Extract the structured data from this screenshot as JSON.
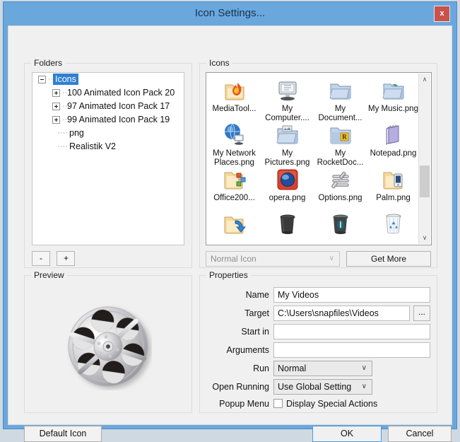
{
  "window": {
    "title": "Icon Settings...",
    "close_label": "x",
    "accent": "#6aa7dd",
    "close_bg": "#c9524a"
  },
  "folders": {
    "legend": "Folders",
    "tree": [
      {
        "label": "Icons",
        "expander": "minus",
        "level": 0,
        "selected": true
      },
      {
        "label": "100 Animated Icon Pack  20",
        "expander": "plus",
        "level": 1,
        "selected": false
      },
      {
        "label": "97 Animated Icon Pack  17",
        "expander": "plus",
        "level": 1,
        "selected": false
      },
      {
        "label": "99 Animated Icon Pack  19",
        "expander": "plus",
        "level": 1,
        "selected": false
      },
      {
        "label": "png",
        "expander": "none",
        "level": 1,
        "selected": false
      },
      {
        "label": "Realistik V2",
        "expander": "none",
        "level": 1,
        "selected": false
      }
    ],
    "remove_label": "-",
    "add_label": "+"
  },
  "preview": {
    "legend": "Preview",
    "icon_name": "film-reel-icon"
  },
  "icons": {
    "legend": "Icons",
    "items": [
      {
        "caption": "MediaTool...",
        "icon": "folder-flame-icon"
      },
      {
        "caption": "My Computer....",
        "icon": "monitor-icon"
      },
      {
        "caption": "My Document...",
        "icon": "folder-documents-icon"
      },
      {
        "caption": "My Music.png",
        "icon": "folder-music-icon"
      },
      {
        "caption": "My Network Places.png",
        "icon": "network-globe-icon"
      },
      {
        "caption": "My Pictures.png",
        "icon": "folder-pictures-icon"
      },
      {
        "caption": "My RocketDoc...",
        "icon": "folder-rocketdock-icon"
      },
      {
        "caption": "Notepad.png",
        "icon": "notepad-icon"
      },
      {
        "caption": "Office200...",
        "icon": "folder-office-icon"
      },
      {
        "caption": "opera.png",
        "icon": "opera-icon"
      },
      {
        "caption": "Options.png",
        "icon": "options-tools-icon"
      },
      {
        "caption": "Palm.png",
        "icon": "folder-palm-icon"
      },
      {
        "caption": "",
        "icon": "folder-restore-icon"
      },
      {
        "caption": "",
        "icon": "trash-black-icon"
      },
      {
        "caption": "",
        "icon": "trash-dark-icon"
      },
      {
        "caption": "",
        "icon": "recycle-bin-icon"
      }
    ],
    "type_select_value": "Normal Icon",
    "get_more_label": "Get More",
    "scroll_up": "∧",
    "scroll_down": "∨"
  },
  "properties": {
    "legend": "Properties",
    "fields": [
      {
        "label": "Name",
        "value": "My Videos",
        "kind": "text"
      },
      {
        "label": "Target",
        "value": "C:\\Users\\snapfiles\\Videos",
        "kind": "text-browse"
      },
      {
        "label": "Start in",
        "value": "",
        "kind": "text"
      },
      {
        "label": "Arguments",
        "value": "",
        "kind": "text"
      },
      {
        "label": "Run",
        "value": "Normal",
        "kind": "combo"
      },
      {
        "label": "Open Running",
        "value": "Use Global Setting",
        "kind": "combo"
      },
      {
        "label": "Popup Menu",
        "value": "Display Special Actions",
        "kind": "checkbox",
        "checked": false
      }
    ],
    "browse_label": "...",
    "caret": "∨"
  },
  "footer": {
    "default_icon_label": "Default Icon",
    "ok_label": "OK",
    "cancel_label": "Cancel"
  }
}
